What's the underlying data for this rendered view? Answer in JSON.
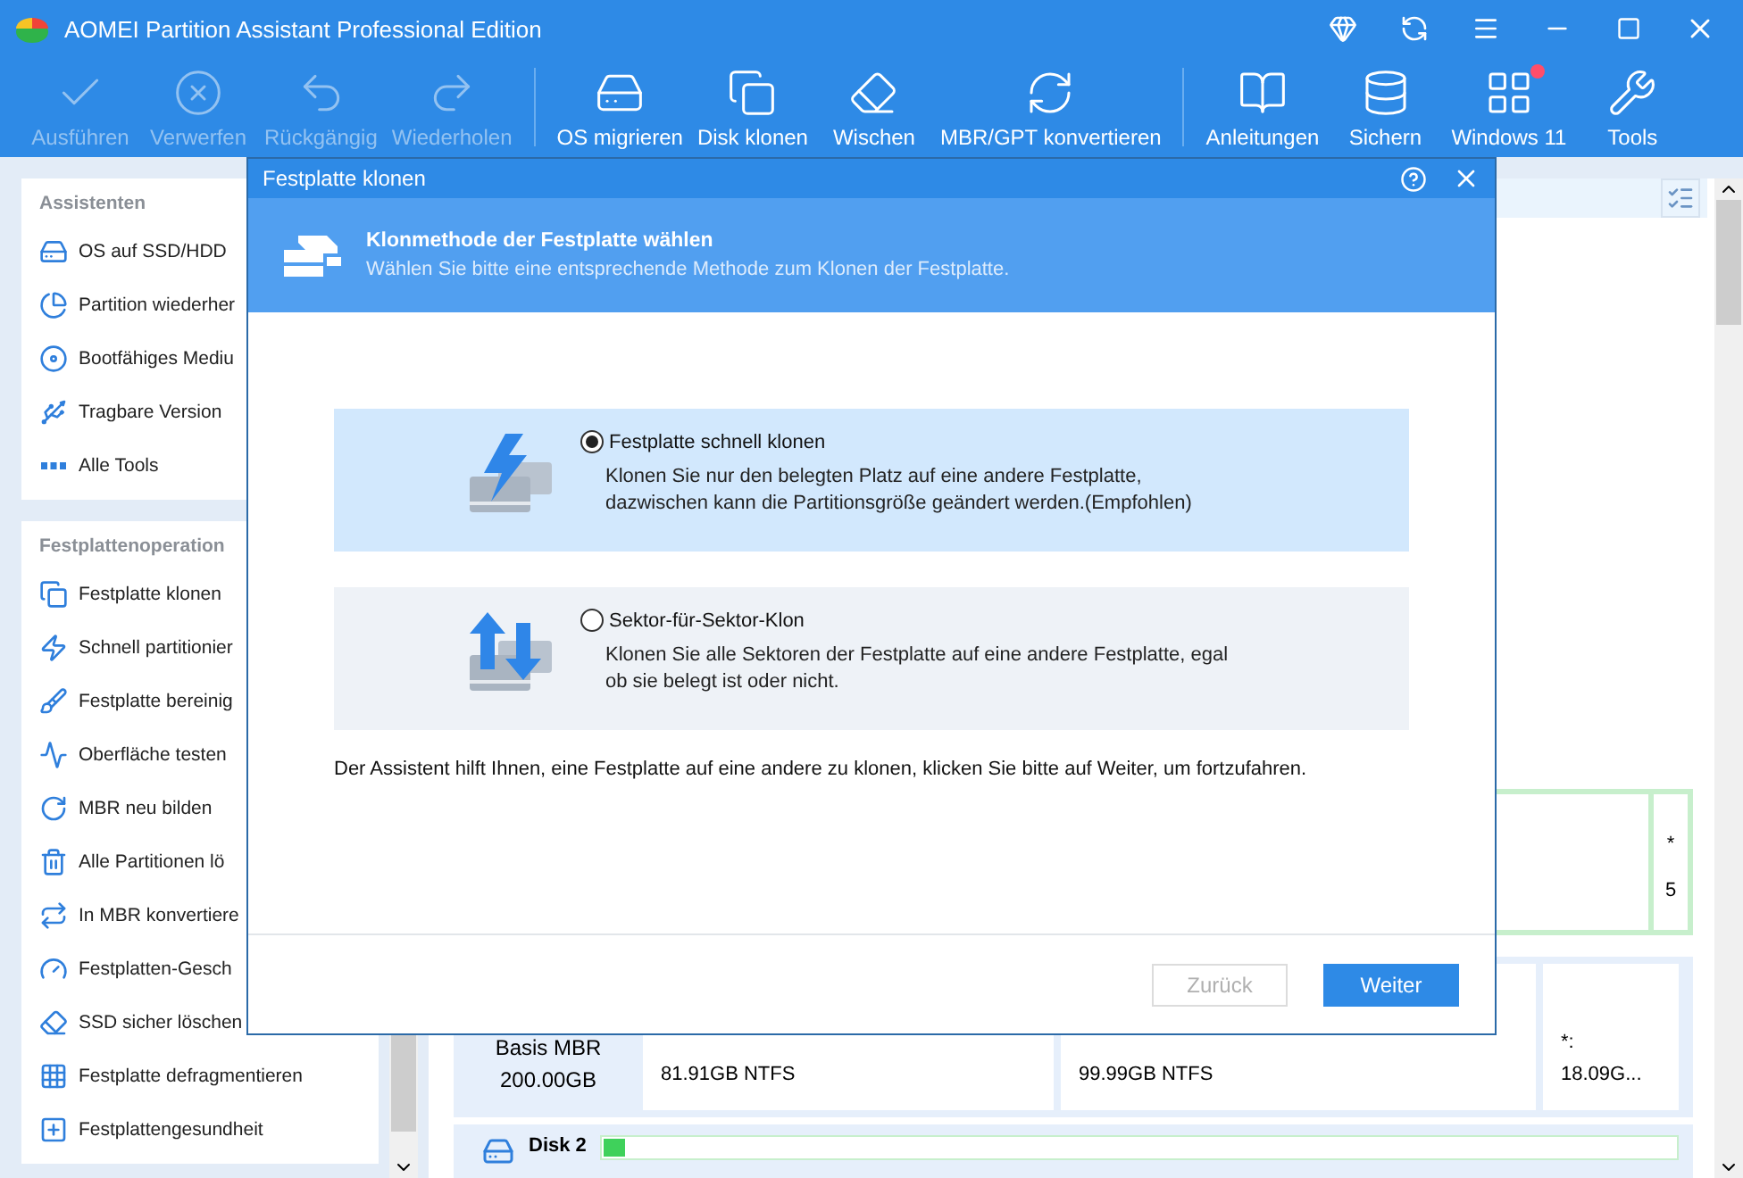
{
  "window": {
    "title": "AOMEI Partition Assistant Professional Edition"
  },
  "toolbar": {
    "groups": [
      {
        "items": [
          {
            "label": "Ausführen",
            "disabled": true,
            "notification": false
          },
          {
            "label": "Verwerfen",
            "disabled": true,
            "notification": false
          },
          {
            "label": "Rückgängig",
            "disabled": true,
            "notification": false
          },
          {
            "label": "Wiederholen",
            "disabled": true,
            "notification": false
          }
        ]
      },
      {
        "items": [
          {
            "label": "OS migrieren",
            "disabled": false,
            "notification": false
          },
          {
            "label": "Disk klonen",
            "disabled": false,
            "notification": false
          },
          {
            "label": "Wischen",
            "disabled": false,
            "notification": false
          },
          {
            "label": "MBR/GPT konvertieren",
            "disabled": false,
            "notification": false
          }
        ]
      },
      {
        "items": [
          {
            "label": "Anleitungen",
            "disabled": false,
            "notification": false
          },
          {
            "label": "Sichern",
            "disabled": false,
            "notification": false
          },
          {
            "label": "Windows 11",
            "disabled": false,
            "notification": true
          },
          {
            "label": "Tools",
            "disabled": false,
            "notification": false
          }
        ]
      }
    ]
  },
  "sidebar": {
    "sections": [
      {
        "title": "Assistenten",
        "items": [
          "OS auf SSD/HDD",
          "Partition wiederher",
          "Bootfähiges Mediu",
          "Tragbare Version",
          "Alle Tools"
        ]
      },
      {
        "title": "Festplattenoperation",
        "items": [
          "Festplatte klonen",
          "Schnell partitionier",
          "Festplatte bereinig",
          "Oberfläche testen",
          "MBR neu bilden",
          "Alle Partitionen lö",
          "In MBR konvertiere",
          "Festplatten-Gesch",
          "SSD sicher löschen",
          "Festplatte defragmentieren",
          "Festplattengesundheit"
        ]
      }
    ]
  },
  "disk_area": {
    "card_1": {
      "lines": [
        "*",
        "5"
      ]
    },
    "disk_1": {
      "type": "Basis MBR",
      "size": "200.00GB",
      "partitions": [
        {
          "info": "81.91GB NTFS"
        },
        {
          "info": "99.99GB NTFS"
        },
        {
          "label": "*:",
          "info": "18.09G..."
        }
      ]
    },
    "disk_2": {
      "name": "Disk 2"
    }
  },
  "dialog": {
    "title": "Festplatte klonen",
    "heading": "Klonmethode der Festplatte wählen",
    "subheading": "Wählen Sie bitte eine entsprechende Methode zum Klonen der Festplatte.",
    "options": [
      {
        "kind": "fast",
        "label": "Festplatte schnell klonen",
        "description": [
          "Klonen Sie nur den belegten Platz auf eine andere Festplatte,",
          "dazwischen kann die Partitionsgröße geändert werden.(Empfohlen)"
        ],
        "selected": true
      },
      {
        "kind": "sector",
        "label": "Sektor-für-Sektor-Klon",
        "description": [
          "Klonen Sie alle Sektoren der Festplatte auf eine andere Festplatte, egal",
          "ob sie belegt ist oder nicht."
        ],
        "selected": false
      }
    ],
    "hint": "Der Assistent hilft Ihnen, eine Festplatte auf eine andere zu klonen, klicken Sie bitte auf Weiter, um fortzufahren.",
    "buttons": [
      {
        "label": "Zurück",
        "disabled": true,
        "primary": false
      },
      {
        "label": "Weiter",
        "disabled": false,
        "primary": true
      }
    ]
  }
}
